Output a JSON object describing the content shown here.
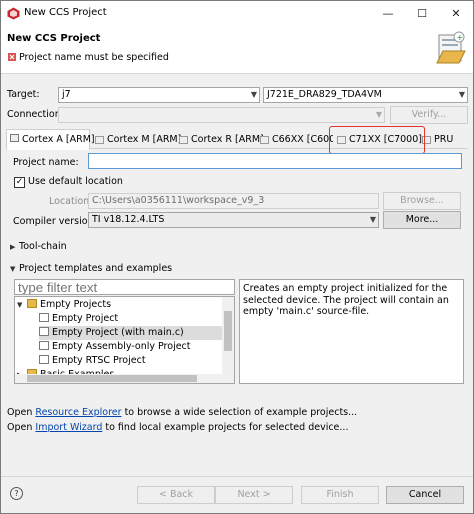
{
  "window": {
    "title": "New CCS Project",
    "minimize": "—",
    "maximize": "☐",
    "close": "✕"
  },
  "header": {
    "title": "New CCS Project",
    "message": "Project name must be specified"
  },
  "target": {
    "label": "Target:",
    "family_value": "j7",
    "device_value": "J721E_DRA829_TDA4VM"
  },
  "connection": {
    "label": "Connection:",
    "value": "",
    "verify_label": "Verify..."
  },
  "tabs": [
    {
      "label": "Cortex A [ARM]",
      "active": true
    },
    {
      "label": "Cortex M [ARM]"
    },
    {
      "label": "Cortex R [ARM]"
    },
    {
      "label": "C66XX [C6000]"
    },
    {
      "label": "C71XX [C7000]"
    },
    {
      "label": "PRU"
    }
  ],
  "project": {
    "name_label": "Project name:",
    "name_value": "",
    "use_default_label": "Use default location",
    "use_default_checked": true,
    "location_label": "Location:",
    "location_value": "C:\\Users\\a0356111\\workspace_v9_3",
    "browse_label": "Browse...",
    "compiler_label": "Compiler version:",
    "compiler_value": "TI v18.12.4.LTS",
    "more_label": "More..."
  },
  "toolchain": {
    "label": "Tool-chain"
  },
  "templates": {
    "label": "Project templates and examples",
    "filter_placeholder": "type filter text",
    "tree": [
      {
        "label": "Empty Projects",
        "type": "folder",
        "level": 1,
        "expanded": true
      },
      {
        "label": "Empty Project",
        "type": "file",
        "level": 2
      },
      {
        "label": "Empty Project (with main.c)",
        "type": "file",
        "level": 2,
        "selected": true
      },
      {
        "label": "Empty Assembly-only Project",
        "type": "file",
        "level": 2
      },
      {
        "label": "Empty RTSC Project",
        "type": "file",
        "level": 2
      },
      {
        "label": "Basic Examples",
        "type": "folder",
        "level": 1,
        "expanded": false
      }
    ],
    "description": "Creates an empty project initialized for the selected device. The project will contain an empty 'main.c' source-file."
  },
  "footer_text": {
    "line1_prefix": "Open ",
    "line1_link": "Resource Explorer",
    "line1_suffix": " to browse a wide selection of example projects...",
    "line2_prefix": "Open ",
    "line2_link": "Import Wizard",
    "line2_suffix": " to find local example projects for selected device..."
  },
  "buttons": {
    "help": "?",
    "back": "< Back",
    "next": "Next >",
    "finish": "Finish",
    "cancel": "Cancel"
  },
  "colors": {
    "highlight": "#e0342d",
    "link": "#0645ad"
  }
}
